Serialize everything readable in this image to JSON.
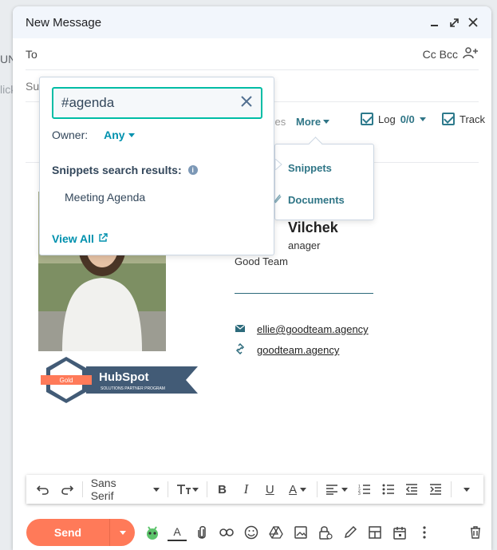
{
  "background": {
    "frag1": "UN",
    "frag2": "lick"
  },
  "window": {
    "title": "New Message"
  },
  "fields": {
    "to_label": "To",
    "cc_bcc": "Cc Bcc",
    "subject_label": "Su"
  },
  "toolbar": {
    "ces_text": "ces",
    "more_label": "More",
    "log_label": "Log",
    "log_count": "0/0",
    "track_label": "Track"
  },
  "snippets": {
    "search_value": "#agenda",
    "owner_label": "Owner:",
    "owner_value": "Any",
    "results_heading": "Snippets search results:",
    "results": [
      "Meeting Agenda"
    ],
    "view_all": "View All"
  },
  "more_menu": {
    "items": [
      "Snippets",
      "Documents"
    ]
  },
  "signature": {
    "name_fragment": "Vilchek",
    "role_fragment": "anager",
    "team": "Good Team",
    "email": "ellie@goodteam.agency",
    "website": "goodteam.agency",
    "badge_tier": "Gold",
    "badge_brand": "HubSpot",
    "badge_program": "SOLUTIONS PARTNER PROGRAM"
  },
  "format": {
    "font": "Sans Serif"
  },
  "send": {
    "label": "Send"
  },
  "colors": {
    "accent": "#00bda5",
    "link": "#0091ae",
    "send": "#ff7a59",
    "badge_bg": "#425b76"
  }
}
